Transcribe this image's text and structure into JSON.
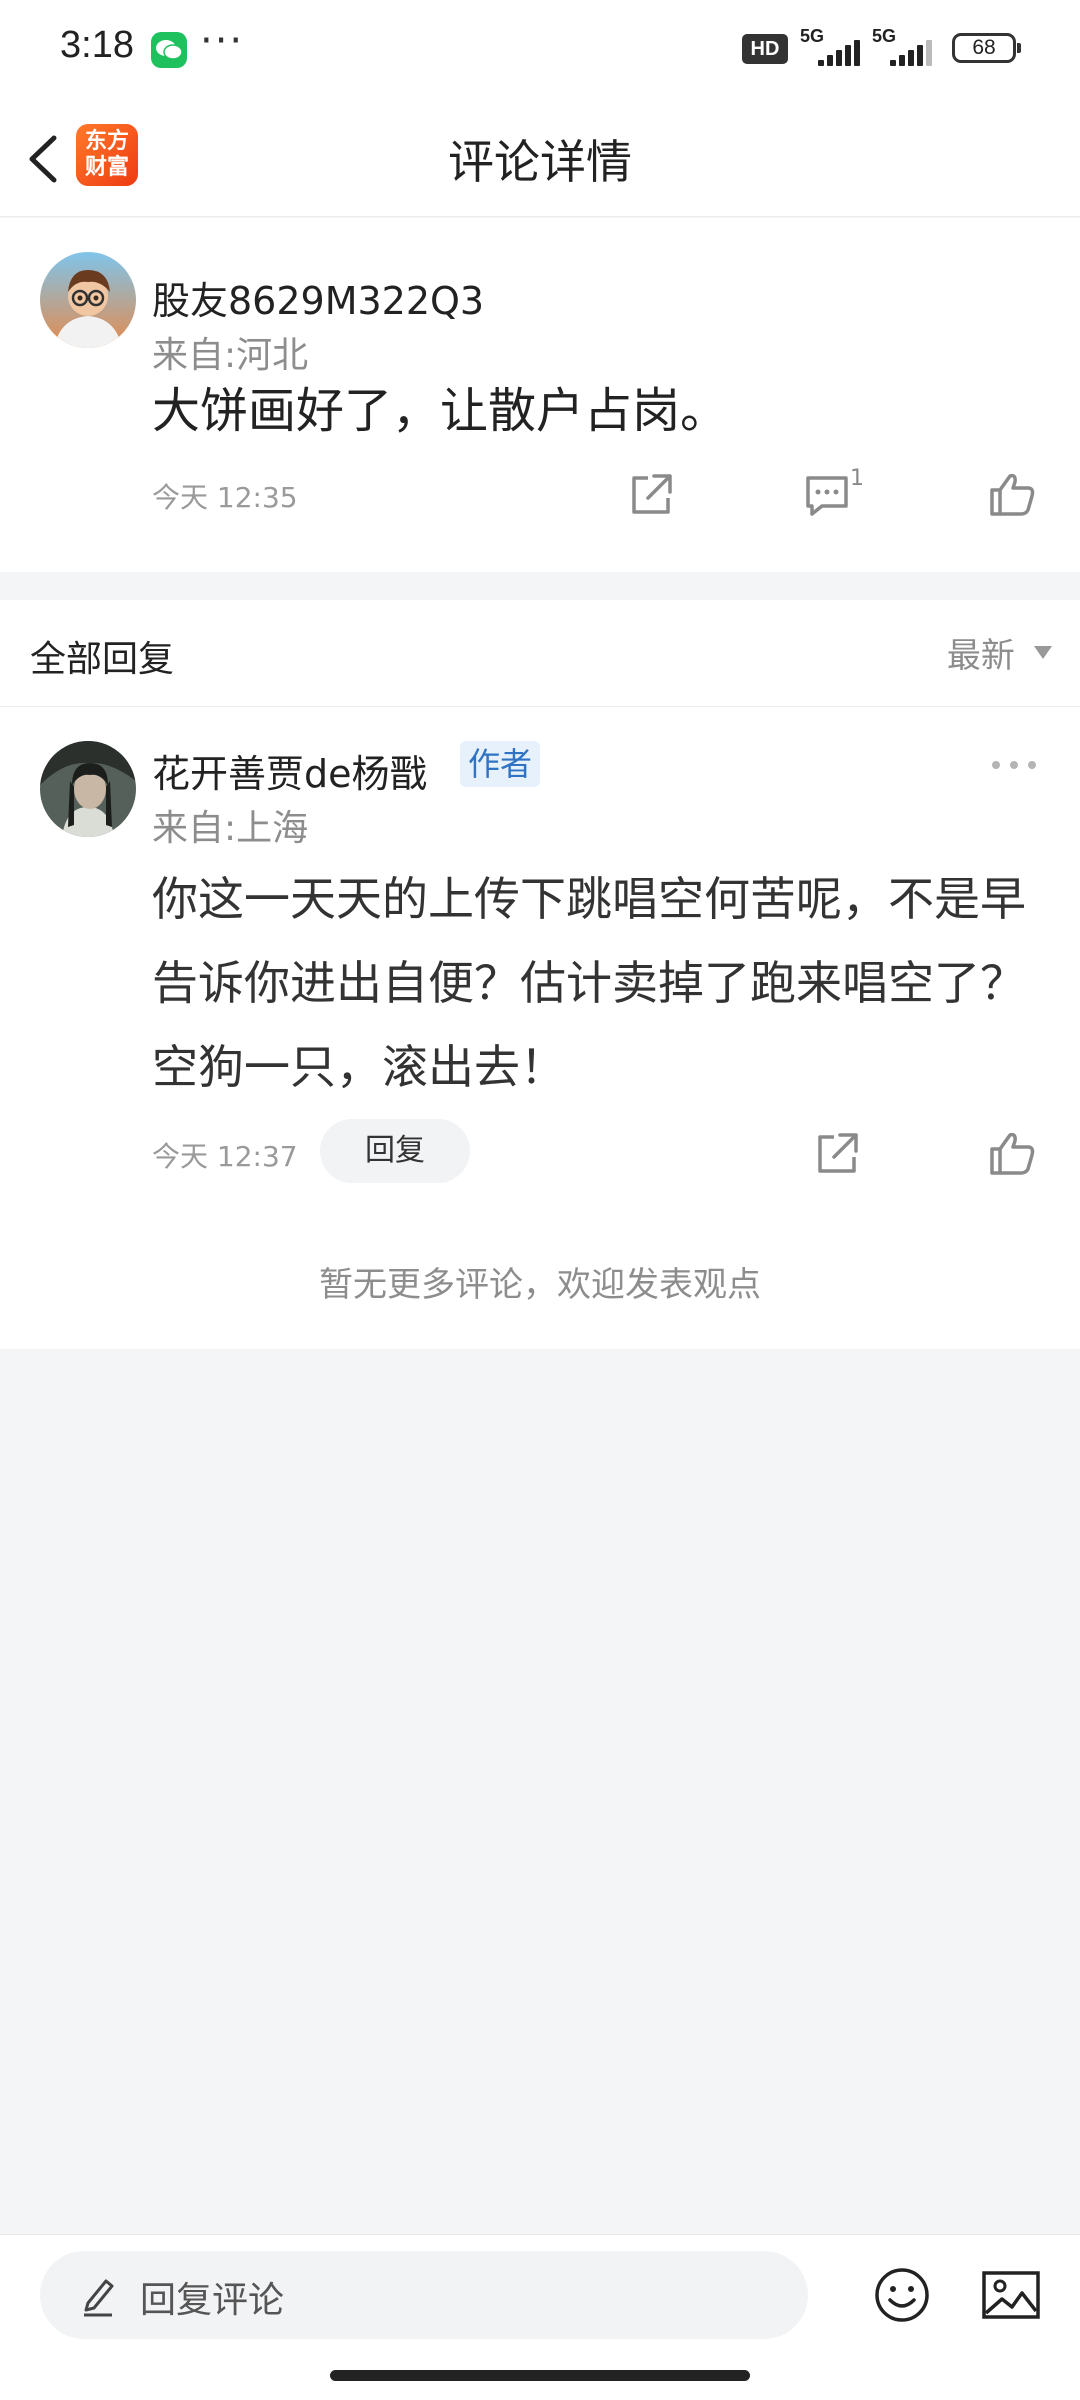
{
  "status_bar": {
    "time": "3:18",
    "dots": "···",
    "network_badge": "HD",
    "signal1": "5G",
    "signal2": "5G",
    "battery": "68"
  },
  "header": {
    "logo_line1": "东方",
    "logo_line2": "财富",
    "title": "评论详情"
  },
  "main_comment": {
    "username": "股友8629M322Q3",
    "location": "来自:河北",
    "text": "大饼画好了，让散户占岗。",
    "timestamp": "今天 12:35",
    "reply_count": "1"
  },
  "replies_section": {
    "title": "全部回复",
    "sort_label": "最新"
  },
  "reply": {
    "username": "花开善贾de杨戬",
    "badge": "作者",
    "location": "来自:上海",
    "text": "你这一天天的上传下跳唱空何苦呢，不是早告诉你进出自便？估计卖掉了跑来唱空了？空狗一只，滚出去！",
    "timestamp": "今天 12:37",
    "reply_button": "回复"
  },
  "footer_note": "暂无更多评论，欢迎发表观点",
  "bottom_bar": {
    "input_placeholder": "回复评论"
  },
  "colors": {
    "accent_orange": "#ee3a12",
    "author_badge_text": "#2f73c2",
    "author_badge_bg": "#e7f1fb",
    "page_bg": "#f4f5f7"
  }
}
